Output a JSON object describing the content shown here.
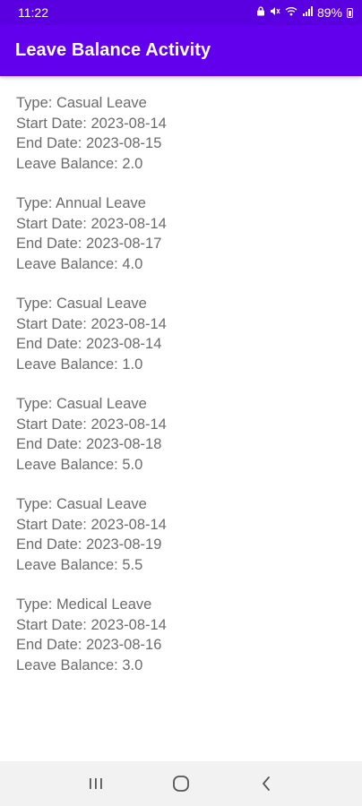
{
  "status_bar": {
    "time": "11:22",
    "battery_percent": "89%",
    "icons": [
      "lock-icon",
      "mute-icon",
      "wifi-icon",
      "signal-icon",
      "battery-icon"
    ]
  },
  "app_bar": {
    "title": "Leave Balance Activity"
  },
  "colors": {
    "status_bar": "#5a00e0",
    "app_bar": "#6200ee",
    "text": "#6b6b6b",
    "nav_bar": "#f2f2f2"
  },
  "leaves": [
    {
      "type": "Type: Casual Leave",
      "start": "Start Date: 2023-08-14",
      "end": "End Date: 2023-08-15",
      "balance": "Leave Balance: 2.0"
    },
    {
      "type": "Type: Annual Leave",
      "start": "Start Date: 2023-08-14",
      "end": "End Date: 2023-08-17",
      "balance": "Leave Balance: 4.0"
    },
    {
      "type": "Type: Casual Leave",
      "start": "Start Date: 2023-08-14",
      "end": "End Date: 2023-08-14",
      "balance": "Leave Balance: 1.0"
    },
    {
      "type": "Type: Casual Leave",
      "start": "Start Date: 2023-08-14",
      "end": "End Date: 2023-08-18",
      "balance": "Leave Balance: 5.0"
    },
    {
      "type": "Type: Casual Leave",
      "start": "Start Date: 2023-08-14",
      "end": "End Date: 2023-08-19",
      "balance": "Leave Balance: 5.5"
    },
    {
      "type": "Type: Medical Leave",
      "start": "Start Date: 2023-08-14",
      "end": "End Date: 2023-08-16",
      "balance": "Leave Balance: 3.0"
    }
  ],
  "nav_bar": {
    "buttons": [
      "recent-apps-icon",
      "home-icon",
      "back-icon"
    ]
  }
}
